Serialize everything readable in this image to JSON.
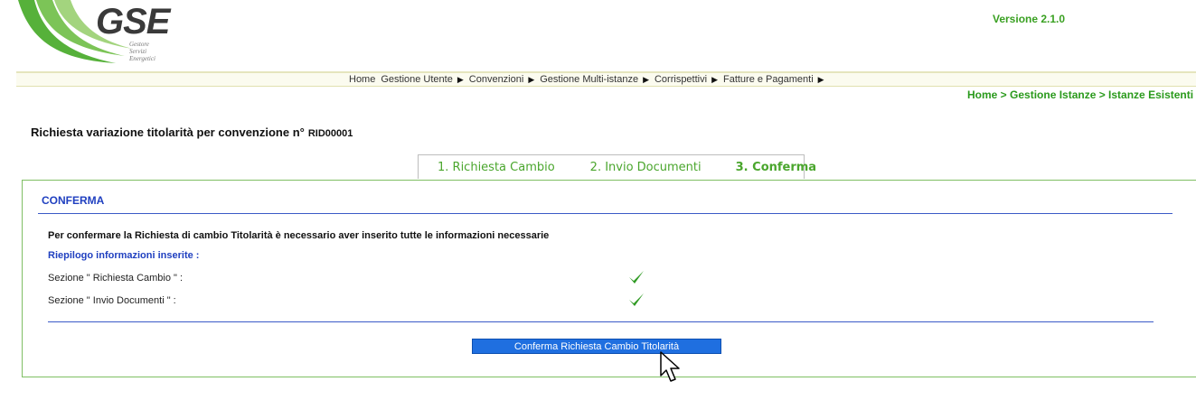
{
  "logo": {
    "name": "GSE",
    "subtitle": [
      "Gestore",
      "Servizi",
      "Energetici"
    ]
  },
  "version": "Versione 2.1.0",
  "nav": {
    "items": [
      {
        "label": "Home",
        "has_arrow": false
      },
      {
        "label": "Gestione Utente",
        "has_arrow": true
      },
      {
        "label": "Convenzioni",
        "has_arrow": true
      },
      {
        "label": "Gestione Multi-istanze",
        "has_arrow": true
      },
      {
        "label": "Corrispettivi",
        "has_arrow": true
      },
      {
        "label": "Fatture e Pagamenti",
        "has_arrow": true
      }
    ]
  },
  "breadcrumb": "Home > Gestione Istanze > Istanze Esistenti",
  "page": {
    "title": "Richiesta variazione titolarità per convenzione n°",
    "code": "RID00001"
  },
  "steps": [
    {
      "label": "1. Richiesta Cambio",
      "active": false
    },
    {
      "label": "2. Invio Documenti",
      "active": false
    },
    {
      "label": "3. Conferma",
      "active": true
    }
  ],
  "panel": {
    "title": "CONFERMA",
    "message": "Per confermare la Richiesta di cambio Titolarità è necessario aver inserito tutte le informazioni necessarie",
    "summary_title": "Riepilogo informazioni inserite :",
    "sections": [
      {
        "label": "Sezione \" Richiesta Cambio \" :",
        "status": "check-icon"
      },
      {
        "label": "Sezione \" Invio Documenti \" :",
        "status": "check-icon"
      }
    ],
    "confirm_button": "Conferma Richiesta Cambio Titolarità"
  },
  "colors": {
    "brand_green": "#39a021",
    "link_blue": "#2040c0",
    "button_blue": "#1f6fe0"
  }
}
